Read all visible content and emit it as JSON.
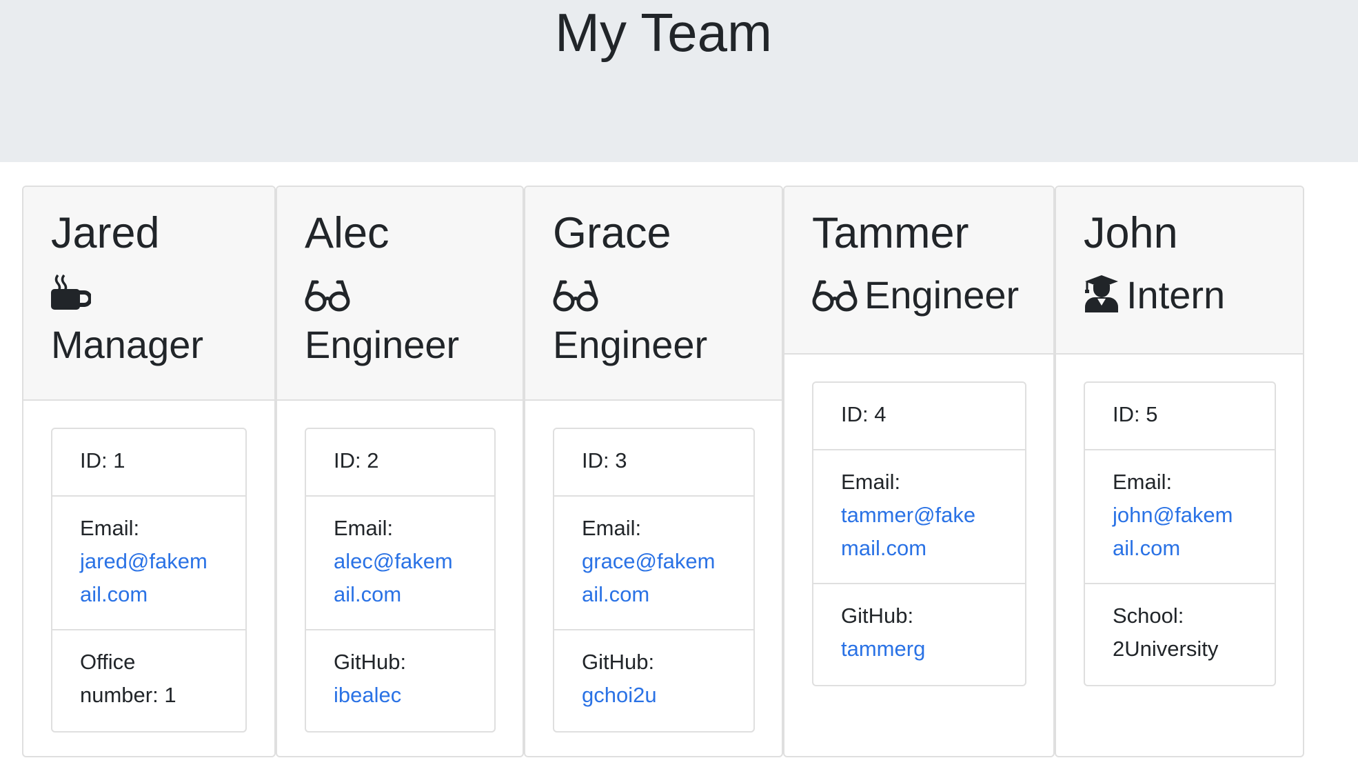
{
  "page": {
    "title": "My Team"
  },
  "team": [
    {
      "name": "Jared",
      "icon": "coffee-mug-icon",
      "role": "Manager",
      "id_text": "ID: 1",
      "email_label": "Email:",
      "email_line1": "jared@fakem",
      "email_line2": "ail.com",
      "extra_line1": "Office",
      "extra_line2": "number: 1"
    },
    {
      "name": "Alec",
      "icon": "glasses-icon",
      "role": "Engineer",
      "id_text": "ID: 2",
      "email_label": "Email:",
      "email_line1": "alec@fakem",
      "email_line2": "ail.com",
      "extra_label": "GitHub:",
      "extra_value": "ibealec"
    },
    {
      "name": "Grace",
      "icon": "glasses-icon",
      "role": "Engineer",
      "id_text": "ID: 3",
      "email_label": "Email:",
      "email_line1": "grace@fakem",
      "email_line2": "ail.com",
      "extra_label": "GitHub:",
      "extra_value": "gchoi2u"
    },
    {
      "name": "Tammer",
      "icon": "glasses-icon",
      "role": "Engineer",
      "id_text": "ID: 4",
      "email_label": "Email:",
      "email_line1": "tammer@fake",
      "email_line2": "mail.com",
      "extra_label": "GitHub:",
      "extra_value": "tammerg"
    },
    {
      "name": "John",
      "icon": "graduate-icon",
      "role": "Intern",
      "id_text": "ID: 5",
      "email_label": "Email:",
      "email_line1": "john@fakem",
      "email_line2": "ail.com",
      "extra_label": "School:",
      "extra_value": "2University"
    }
  ],
  "colors": {
    "link": "#2a72e5",
    "hero": "#e9ecef",
    "header": "#f7f7f7"
  }
}
